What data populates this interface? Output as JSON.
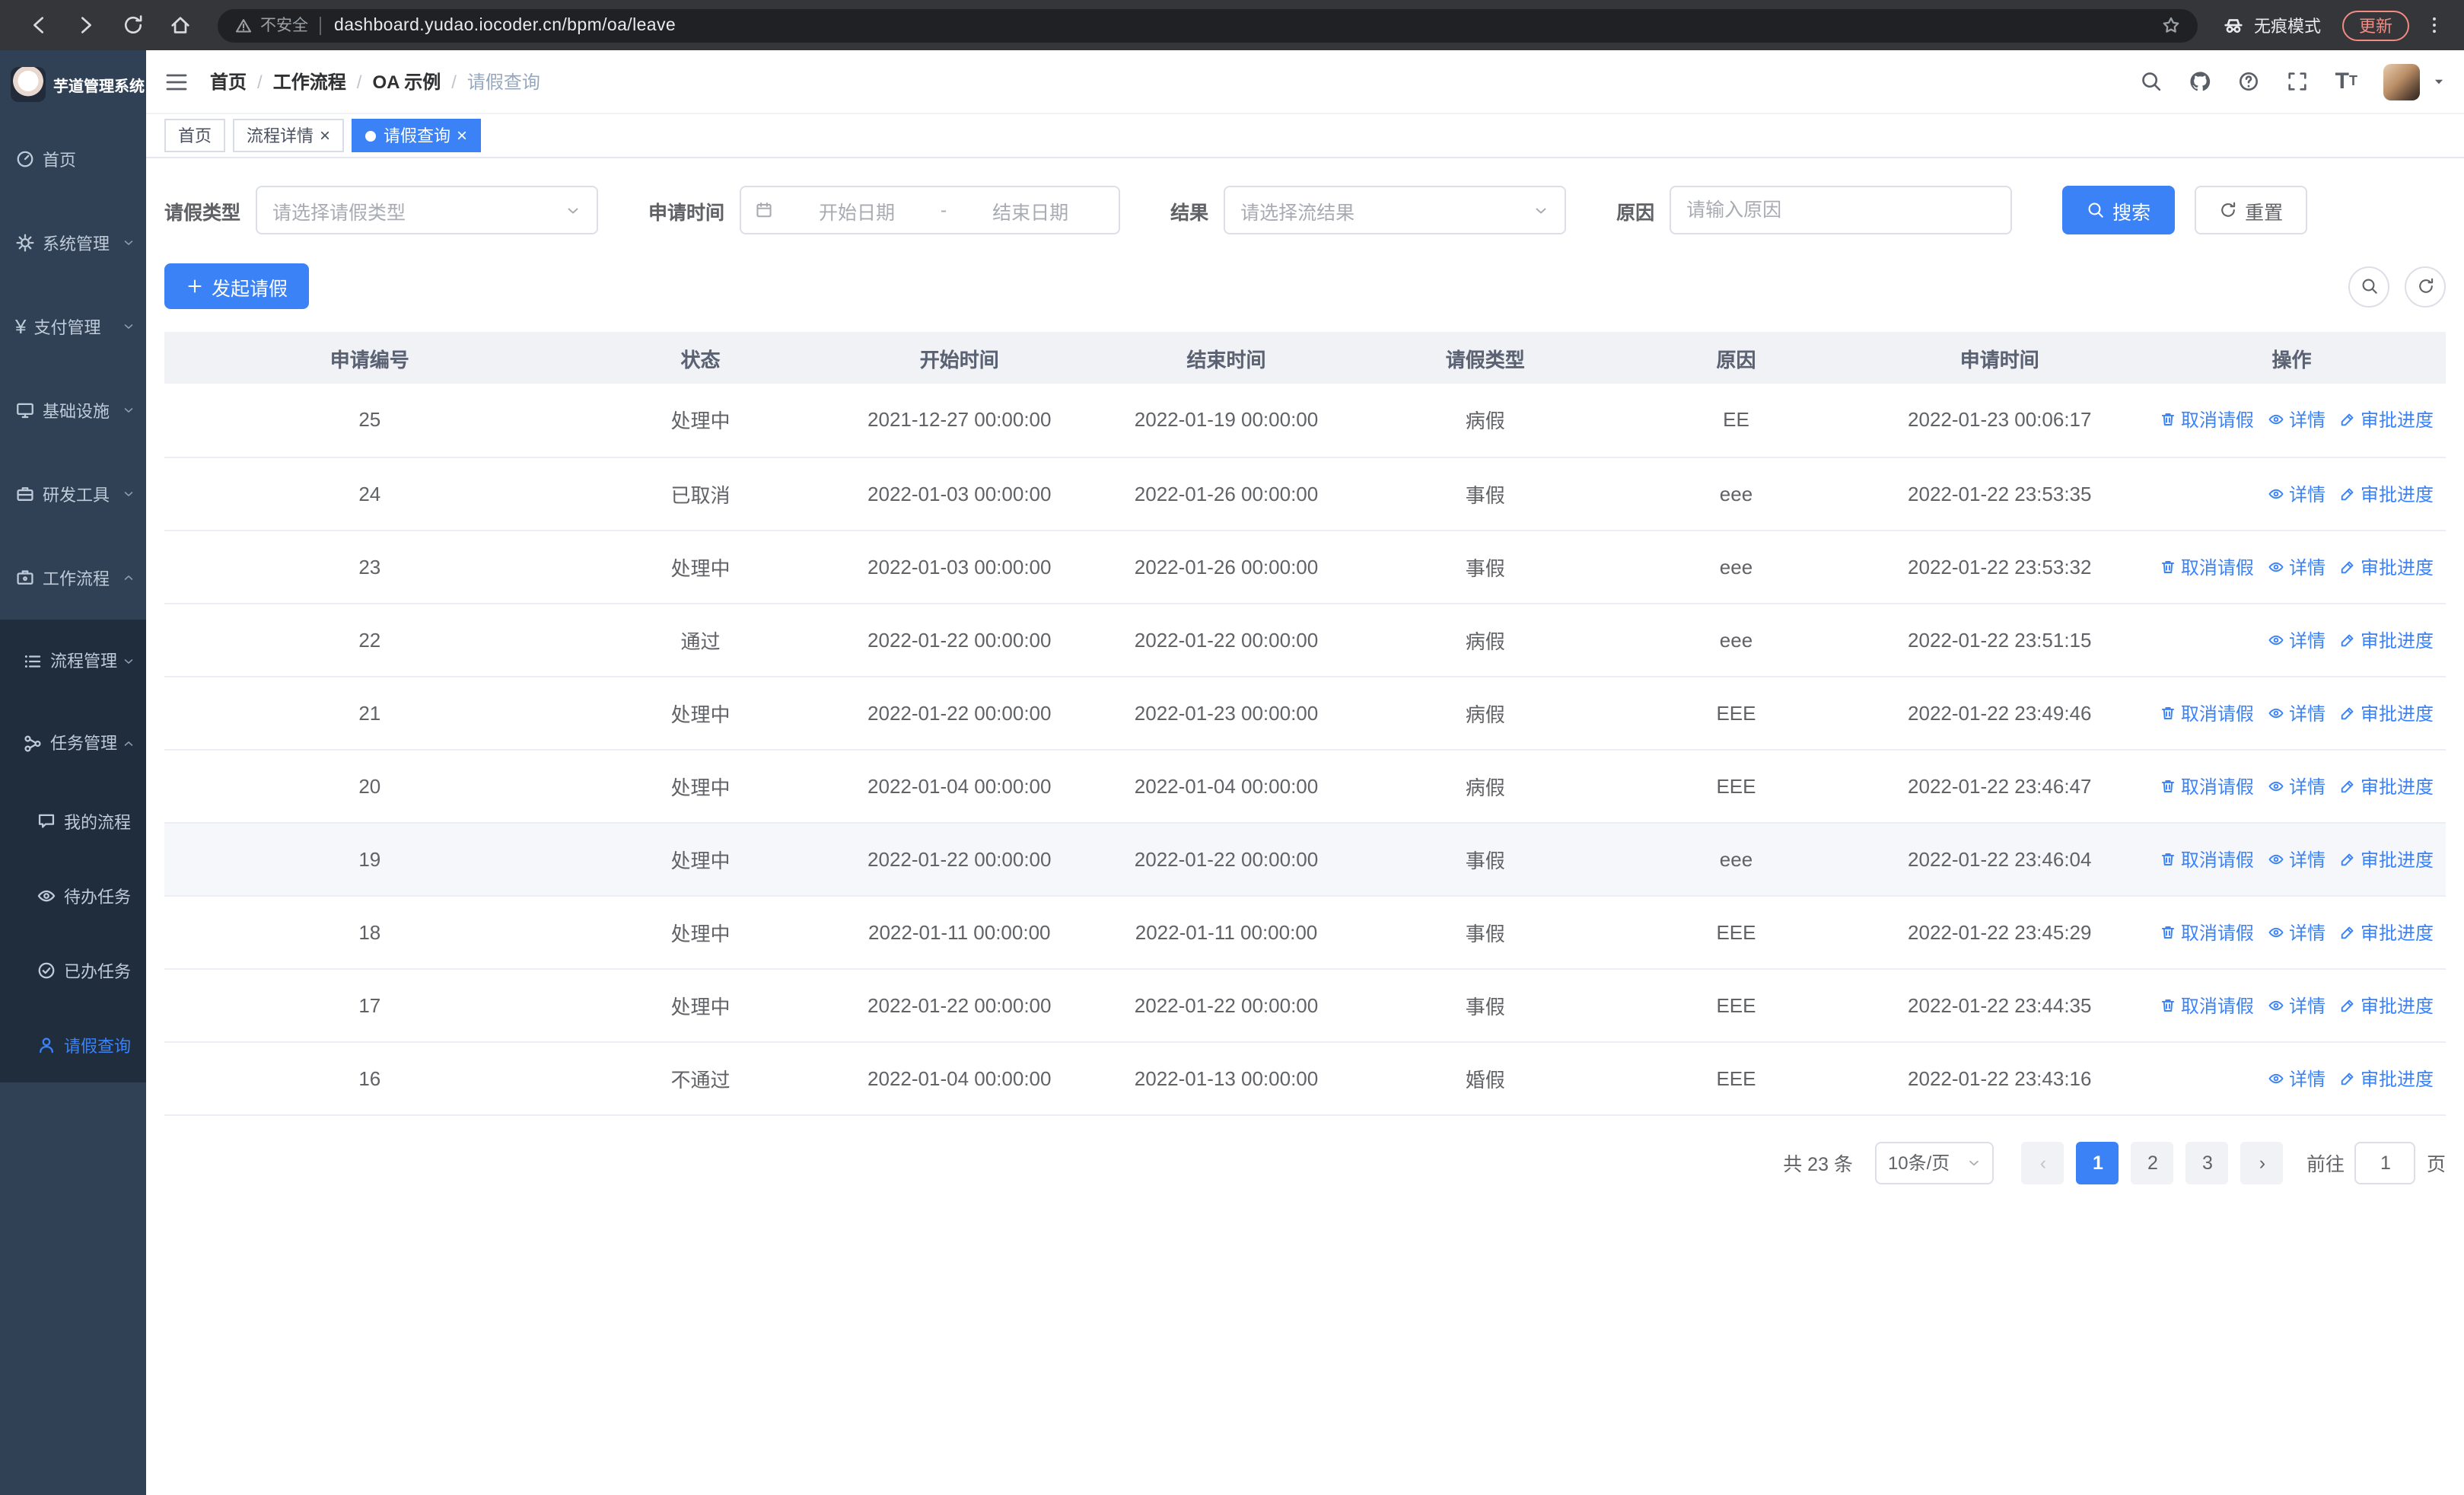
{
  "browser": {
    "url": "dashboard.yudao.iocoder.cn/bpm/oa/leave",
    "security_label": "不安全",
    "incognito_label": "无痕模式",
    "update_label": "更新"
  },
  "sidebar": {
    "logo_title": "芋道管理系统",
    "menu": [
      {
        "label": "首页",
        "icon": "dashboard-icon",
        "level": 1
      },
      {
        "label": "系统管理",
        "icon": "gear-icon",
        "level": 1,
        "chevron": "down"
      },
      {
        "label": "支付管理",
        "icon": "yen-icon",
        "level": 1,
        "chevron": "down"
      },
      {
        "label": "基础设施",
        "icon": "monitor-icon",
        "level": 1,
        "chevron": "down"
      },
      {
        "label": "研发工具",
        "icon": "toolbox-icon",
        "level": 1,
        "chevron": "down"
      },
      {
        "label": "工作流程",
        "icon": "workflow-icon",
        "level": 1,
        "chevron": "up"
      },
      {
        "label": "流程管理",
        "icon": "list-icon",
        "level": 2,
        "chevron": "down"
      },
      {
        "label": "任务管理",
        "icon": "tasks-icon",
        "level": 2,
        "chevron": "up"
      },
      {
        "label": "我的流程",
        "icon": "chat-icon",
        "level": 3
      },
      {
        "label": "待办任务",
        "icon": "eye-icon",
        "level": 3
      },
      {
        "label": "已办任务",
        "icon": "done-icon",
        "level": 3
      },
      {
        "label": "请假查询",
        "icon": "user-icon",
        "level": 3,
        "active": true
      }
    ]
  },
  "header": {
    "breadcrumb": [
      "首页",
      "工作流程",
      "OA 示例",
      "请假查询"
    ],
    "right_icons": [
      "search-icon",
      "github-icon",
      "help-icon",
      "fullscreen-icon",
      "fontsize-icon"
    ]
  },
  "tags": [
    {
      "label": "首页",
      "closable": false,
      "active": false
    },
    {
      "label": "流程详情",
      "closable": true,
      "active": false
    },
    {
      "label": "请假查询",
      "closable": true,
      "active": true
    }
  ],
  "filters": {
    "leave_type_label": "请假类型",
    "leave_type_placeholder": "请选择请假类型",
    "apply_time_label": "申请时间",
    "start_date_placeholder": "开始日期",
    "range_separator": "-",
    "end_date_placeholder": "结束日期",
    "result_label": "结果",
    "result_placeholder": "请选择流结果",
    "reason_label": "原因",
    "reason_placeholder": "请输入原因",
    "search_button": "搜索",
    "reset_button": "重置"
  },
  "toolbar": {
    "create_button": "发起请假"
  },
  "table": {
    "columns": [
      "申请编号",
      "状态",
      "开始时间",
      "结束时间",
      "请假类型",
      "原因",
      "申请时间",
      "操作"
    ],
    "action_labels": {
      "cancel": "取消请假",
      "detail": "详情",
      "progress": "审批进度"
    },
    "highlight_row": 6,
    "rows": [
      {
        "id": "25",
        "status": "处理中",
        "start": "2021-12-27 00:00:00",
        "end": "2022-01-19 00:00:00",
        "type": "病假",
        "reason": "EE",
        "applied": "2022-01-23 00:06:17",
        "actions": [
          "cancel",
          "detail",
          "progress"
        ]
      },
      {
        "id": "24",
        "status": "已取消",
        "start": "2022-01-03 00:00:00",
        "end": "2022-01-26 00:00:00",
        "type": "事假",
        "reason": "eee",
        "applied": "2022-01-22 23:53:35",
        "actions": [
          "detail",
          "progress"
        ]
      },
      {
        "id": "23",
        "status": "处理中",
        "start": "2022-01-03 00:00:00",
        "end": "2022-01-26 00:00:00",
        "type": "事假",
        "reason": "eee",
        "applied": "2022-01-22 23:53:32",
        "actions": [
          "cancel",
          "detail",
          "progress"
        ]
      },
      {
        "id": "22",
        "status": "通过",
        "start": "2022-01-22 00:00:00",
        "end": "2022-01-22 00:00:00",
        "type": "病假",
        "reason": "eee",
        "applied": "2022-01-22 23:51:15",
        "actions": [
          "detail",
          "progress"
        ]
      },
      {
        "id": "21",
        "status": "处理中",
        "start": "2022-01-22 00:00:00",
        "end": "2022-01-23 00:00:00",
        "type": "病假",
        "reason": "EEE",
        "applied": "2022-01-22 23:49:46",
        "actions": [
          "cancel",
          "detail",
          "progress"
        ]
      },
      {
        "id": "20",
        "status": "处理中",
        "start": "2022-01-04 00:00:00",
        "end": "2022-01-04 00:00:00",
        "type": "病假",
        "reason": "EEE",
        "applied": "2022-01-22 23:46:47",
        "actions": [
          "cancel",
          "detail",
          "progress"
        ]
      },
      {
        "id": "19",
        "status": "处理中",
        "start": "2022-01-22 00:00:00",
        "end": "2022-01-22 00:00:00",
        "type": "事假",
        "reason": "eee",
        "applied": "2022-01-22 23:46:04",
        "actions": [
          "cancel",
          "detail",
          "progress"
        ]
      },
      {
        "id": "18",
        "status": "处理中",
        "start": "2022-01-11 00:00:00",
        "end": "2022-01-11 00:00:00",
        "type": "事假",
        "reason": "EEE",
        "applied": "2022-01-22 23:45:29",
        "actions": [
          "cancel",
          "detail",
          "progress"
        ]
      },
      {
        "id": "17",
        "status": "处理中",
        "start": "2022-01-22 00:00:00",
        "end": "2022-01-22 00:00:00",
        "type": "事假",
        "reason": "EEE",
        "applied": "2022-01-22 23:44:35",
        "actions": [
          "cancel",
          "detail",
          "progress"
        ]
      },
      {
        "id": "16",
        "status": "不通过",
        "start": "2022-01-04 00:00:00",
        "end": "2022-01-13 00:00:00",
        "type": "婚假",
        "reason": "EEE",
        "applied": "2022-01-22 23:43:16",
        "actions": [
          "detail",
          "progress"
        ]
      }
    ]
  },
  "pagination": {
    "total_text": "共 23 条",
    "page_size_text": "10条/页",
    "pages": [
      "1",
      "2",
      "3"
    ],
    "active_page": "1",
    "goto_label": "前往",
    "goto_value": "1",
    "page_label": "页"
  }
}
